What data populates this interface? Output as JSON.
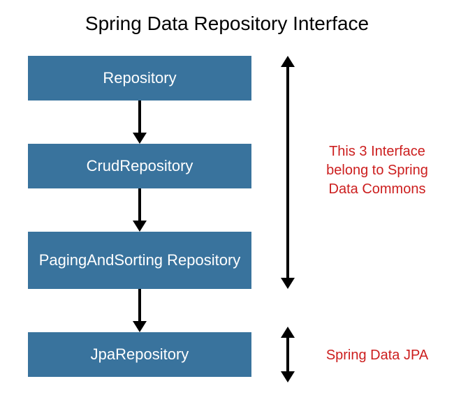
{
  "title": "Spring Data Repository Interface",
  "boxes": {
    "b1": "Repository",
    "b2": "CrudRepository",
    "b3": "PagingAndSorting Repository",
    "b4": "JpaRepository"
  },
  "annotations": {
    "commons": "This 3 Interface belong to Spring Data Commons",
    "jpa": "Spring Data JPA"
  }
}
